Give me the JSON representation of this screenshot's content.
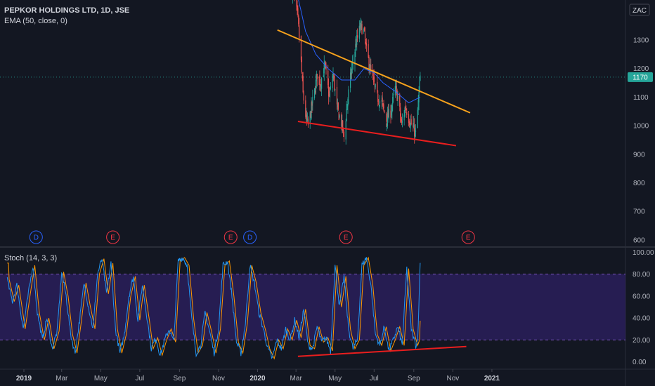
{
  "header": {
    "symbol": "PEPKOR HOLDINGS LTD, 1D, JSE",
    "indicator": "EMA (50, close, 0)",
    "currency": "ZAC",
    "last_price": "1170"
  },
  "stoch_legend": "Stoch (14, 3, 3)",
  "colors": {
    "background": "#131722",
    "up_candle": "#26a69a",
    "down_candle": "#ef5350",
    "ema": "#2962ff",
    "resistance": "#f7a21c",
    "support": "#e91e1e",
    "stoch_k": "#2196f3",
    "stoch_d": "#ff9800",
    "stoch_band": "#2a1f5a",
    "price_label": "#26a69a",
    "dividend": "#2962ff",
    "earnings": "#f23645"
  },
  "x_axis_labels": [
    {
      "label": "2019",
      "date": "2019-01-01",
      "bold": true
    },
    {
      "label": "Mar",
      "date": "2019-03-01",
      "bold": false
    },
    {
      "label": "May",
      "date": "2019-05-01",
      "bold": false
    },
    {
      "label": "Jul",
      "date": "2019-07-01",
      "bold": false
    },
    {
      "label": "Sep",
      "date": "2019-09-01",
      "bold": false
    },
    {
      "label": "Nov",
      "date": "2019-11-01",
      "bold": false
    },
    {
      "label": "2020",
      "date": "2020-01-01",
      "bold": true
    },
    {
      "label": "Mar",
      "date": "2020-03-01",
      "bold": false
    },
    {
      "label": "May",
      "date": "2020-05-01",
      "bold": false
    },
    {
      "label": "Jul",
      "date": "2020-07-01",
      "bold": false
    },
    {
      "label": "Sep",
      "date": "2020-09-01",
      "bold": false
    },
    {
      "label": "Nov",
      "date": "2020-11-01",
      "bold": false
    },
    {
      "label": "2021",
      "date": "2021-01-01",
      "bold": true
    }
  ],
  "events": [
    {
      "letter": "D",
      "date": "2019-01-20",
      "kind": "dividend"
    },
    {
      "letter": "E",
      "date": "2019-05-20",
      "kind": "earnings"
    },
    {
      "letter": "E",
      "date": "2019-11-20",
      "kind": "earnings"
    },
    {
      "letter": "D",
      "date": "2019-12-20",
      "kind": "dividend"
    },
    {
      "letter": "E",
      "date": "2020-05-18",
      "kind": "earnings"
    },
    {
      "letter": "E",
      "date": "2020-11-25",
      "kind": "earnings"
    }
  ],
  "chart_data": [
    {
      "type": "candlestick",
      "title": "PEPKOR HOLDINGS LTD, 1D, JSE",
      "ylim": [
        580,
        1440
      ],
      "yticks": [
        600,
        700,
        800,
        900,
        1000,
        1100,
        1200,
        1300,
        1400
      ],
      "last_price": 1170,
      "price_anchors": [
        [
          "2020-02-24",
          1470
        ],
        [
          "2020-02-28",
          1440
        ],
        [
          "2020-03-04",
          1370
        ],
        [
          "2020-03-09",
          1220
        ],
        [
          "2020-03-12",
          1110
        ],
        [
          "2020-03-17",
          1020
        ],
        [
          "2020-03-20",
          1000
        ],
        [
          "2020-03-25",
          1060
        ],
        [
          "2020-03-30",
          1120
        ],
        [
          "2020-04-03",
          1180
        ],
        [
          "2020-04-08",
          1150
        ],
        [
          "2020-04-15",
          1210
        ],
        [
          "2020-04-22",
          1100
        ],
        [
          "2020-04-28",
          1180
        ],
        [
          "2020-05-04",
          1060
        ],
        [
          "2020-05-11",
          1010
        ],
        [
          "2020-05-15",
          960
        ],
        [
          "2020-05-20",
          1080
        ],
        [
          "2020-05-27",
          1200
        ],
        [
          "2020-06-03",
          1290
        ],
        [
          "2020-06-10",
          1350
        ],
        [
          "2020-06-15",
          1330
        ],
        [
          "2020-06-19",
          1260
        ],
        [
          "2020-06-24",
          1210
        ],
        [
          "2020-06-30",
          1150
        ],
        [
          "2020-07-06",
          1100
        ],
        [
          "2020-07-13",
          1080
        ],
        [
          "2020-07-20",
          1020
        ],
        [
          "2020-07-27",
          1050
        ],
        [
          "2020-08-03",
          1130
        ],
        [
          "2020-08-07",
          1100
        ],
        [
          "2020-08-13",
          1000
        ],
        [
          "2020-08-19",
          1070
        ],
        [
          "2020-08-25",
          1020
        ],
        [
          "2020-08-31",
          990
        ],
        [
          "2020-09-04",
          970
        ],
        [
          "2020-09-08",
          1080
        ],
        [
          "2020-09-11",
          1170
        ]
      ],
      "ema_anchors": [
        [
          "2020-02-24",
          1560
        ],
        [
          "2020-03-02",
          1470
        ],
        [
          "2020-03-16",
          1330
        ],
        [
          "2020-04-01",
          1250
        ],
        [
          "2020-04-20",
          1200
        ],
        [
          "2020-05-11",
          1160
        ],
        [
          "2020-06-01",
          1160
        ],
        [
          "2020-06-15",
          1200
        ],
        [
          "2020-07-01",
          1185
        ],
        [
          "2020-07-15",
          1150
        ],
        [
          "2020-08-03",
          1120
        ],
        [
          "2020-08-24",
          1080
        ],
        [
          "2020-09-11",
          1100
        ]
      ],
      "resistance_line": {
        "from": [
          "2020-02-01",
          1335
        ],
        "to": [
          "2020-11-28",
          1045
        ]
      },
      "support_line": {
        "from": [
          "2020-03-04",
          1015
        ],
        "to": [
          "2020-11-06",
          930
        ]
      }
    },
    {
      "type": "line",
      "title": "Stoch (14, 3, 3)",
      "ylim": [
        -6,
        104
      ],
      "yticks": [
        0,
        20,
        40,
        60,
        80,
        100
      ],
      "band": [
        20,
        80
      ],
      "k_anchors": [
        [
          "2018-12-06",
          75
        ],
        [
          "2018-12-14",
          55
        ],
        [
          "2018-12-21",
          70
        ],
        [
          "2018-12-31",
          30
        ],
        [
          "2019-01-08",
          62
        ],
        [
          "2019-01-15",
          88
        ],
        [
          "2019-01-22",
          45
        ],
        [
          "2019-01-30",
          20
        ],
        [
          "2019-02-06",
          40
        ],
        [
          "2019-02-14",
          12
        ],
        [
          "2019-02-22",
          28
        ],
        [
          "2019-03-01",
          82
        ],
        [
          "2019-03-08",
          60
        ],
        [
          "2019-03-15",
          25
        ],
        [
          "2019-03-22",
          8
        ],
        [
          "2019-03-29",
          38
        ],
        [
          "2019-04-05",
          72
        ],
        [
          "2019-04-12",
          50
        ],
        [
          "2019-04-19",
          30
        ],
        [
          "2019-04-26",
          80
        ],
        [
          "2019-05-03",
          94
        ],
        [
          "2019-05-10",
          62
        ],
        [
          "2019-05-17",
          90
        ],
        [
          "2019-05-24",
          30
        ],
        [
          "2019-05-31",
          8
        ],
        [
          "2019-06-07",
          25
        ],
        [
          "2019-06-14",
          60
        ],
        [
          "2019-06-21",
          78
        ],
        [
          "2019-06-28",
          38
        ],
        [
          "2019-07-05",
          70
        ],
        [
          "2019-07-12",
          42
        ],
        [
          "2019-07-19",
          12
        ],
        [
          "2019-07-26",
          22
        ],
        [
          "2019-08-02",
          6
        ],
        [
          "2019-08-09",
          20
        ],
        [
          "2019-08-16",
          30
        ],
        [
          "2019-08-23",
          18
        ],
        [
          "2019-08-30",
          92
        ],
        [
          "2019-09-06",
          95
        ],
        [
          "2019-09-13",
          88
        ],
        [
          "2019-09-20",
          40
        ],
        [
          "2019-09-27",
          8
        ],
        [
          "2019-10-04",
          15
        ],
        [
          "2019-10-11",
          45
        ],
        [
          "2019-10-18",
          28
        ],
        [
          "2019-10-25",
          8
        ],
        [
          "2019-11-01",
          30
        ],
        [
          "2019-11-08",
          88
        ],
        [
          "2019-11-15",
          92
        ],
        [
          "2019-11-22",
          60
        ],
        [
          "2019-11-29",
          18
        ],
        [
          "2019-12-06",
          8
        ],
        [
          "2019-12-13",
          35
        ],
        [
          "2019-12-20",
          88
        ],
        [
          "2019-12-27",
          72
        ],
        [
          "2020-01-03",
          45
        ],
        [
          "2020-01-10",
          30
        ],
        [
          "2020-01-17",
          12
        ],
        [
          "2020-01-24",
          3
        ],
        [
          "2020-01-31",
          20
        ],
        [
          "2020-02-07",
          12
        ],
        [
          "2020-02-14",
          30
        ],
        [
          "2020-02-21",
          20
        ],
        [
          "2020-02-28",
          38
        ],
        [
          "2020-03-06",
          22
        ],
        [
          "2020-03-13",
          48
        ],
        [
          "2020-03-20",
          15
        ],
        [
          "2020-03-27",
          12
        ],
        [
          "2020-04-03",
          32
        ],
        [
          "2020-04-10",
          18
        ],
        [
          "2020-04-17",
          22
        ],
        [
          "2020-04-24",
          10
        ],
        [
          "2020-05-01",
          88
        ],
        [
          "2020-05-08",
          50
        ],
        [
          "2020-05-15",
          78
        ],
        [
          "2020-05-22",
          30
        ],
        [
          "2020-05-29",
          12
        ],
        [
          "2020-06-05",
          20
        ],
        [
          "2020-06-12",
          88
        ],
        [
          "2020-06-19",
          95
        ],
        [
          "2020-06-26",
          70
        ],
        [
          "2020-07-03",
          25
        ],
        [
          "2020-07-10",
          15
        ],
        [
          "2020-07-17",
          32
        ],
        [
          "2020-07-24",
          10
        ],
        [
          "2020-07-31",
          20
        ],
        [
          "2020-08-07",
          32
        ],
        [
          "2020-08-14",
          15
        ],
        [
          "2020-08-21",
          85
        ],
        [
          "2020-08-28",
          30
        ],
        [
          "2020-09-04",
          15
        ],
        [
          "2020-09-07",
          20
        ],
        [
          "2020-09-11",
          90
        ]
      ],
      "divergence_line": {
        "from": [
          "2020-03-04",
          5
        ],
        "to": [
          "2020-11-22",
          14
        ]
      }
    }
  ]
}
